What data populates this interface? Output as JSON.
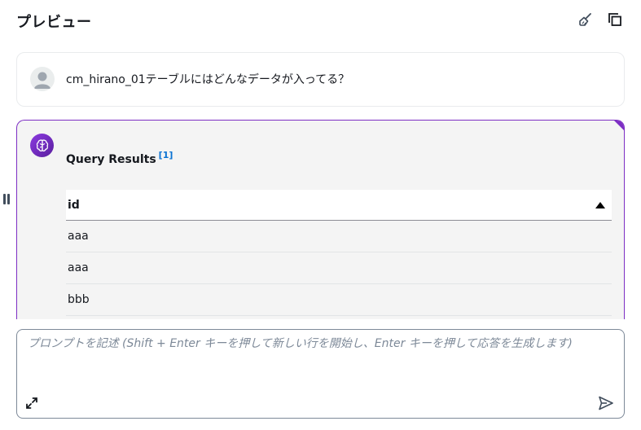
{
  "header": {
    "title": "プレビュー"
  },
  "user_message": {
    "text": "cm_hirano_01テーブルにはどんなデータが入ってる？"
  },
  "ai_message": {
    "title": "Query Results",
    "reference": "[1]",
    "table": {
      "column": "id",
      "rows": [
        "aaa",
        "aaa",
        "bbb"
      ]
    }
  },
  "prompt": {
    "placeholder": "プロンプトを記述 (Shift + Enter キーを押して新しい行を開始し、Enter キーを押して応答を生成します)"
  },
  "colors": {
    "accent": "#7d2ec4",
    "link": "#0972d3"
  }
}
